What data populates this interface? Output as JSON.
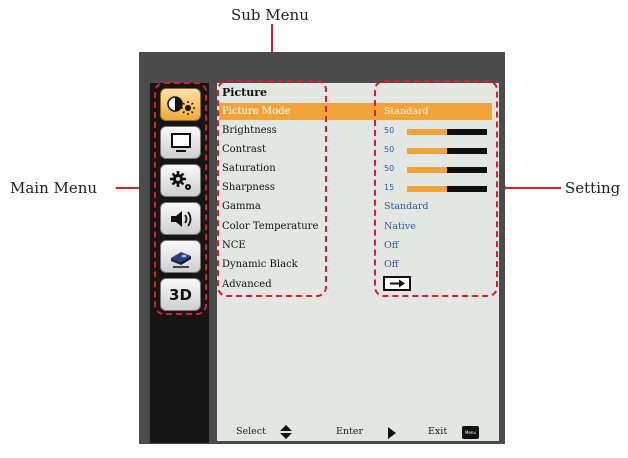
{
  "callouts": {
    "sub_menu": "Sub Menu",
    "main_menu": "Main Menu",
    "setting": "Setting"
  },
  "panel_title": "Picture",
  "menu_items": [
    {
      "label": "Picture Mode",
      "value": "Standard",
      "selected": true
    },
    {
      "label": "Brightness",
      "value": "50",
      "level": 0.5
    },
    {
      "label": "Contrast",
      "value": "50",
      "level": 0.5
    },
    {
      "label": "Saturation",
      "value": "50",
      "level": 0.5
    },
    {
      "label": "Sharpness",
      "value": "15",
      "level": 0.5
    },
    {
      "label": "Gamma",
      "value": "Standard"
    },
    {
      "label": "Color Temperature",
      "value": "Native"
    },
    {
      "label": "NCE",
      "value": "Off"
    },
    {
      "label": "Dynamic Black",
      "value": "Off"
    },
    {
      "label": "Advanced",
      "value_icon": "enter-arrow-icon"
    }
  ],
  "sidebar_icons": [
    "picture-icon",
    "screen-icon",
    "settings-icon",
    "volume-icon",
    "options-icon",
    "3d-icon"
  ],
  "sidebar_3d_label": "3D",
  "footer": {
    "select": "Select",
    "enter": "Enter",
    "exit": "Exit",
    "menu_key": "Menu"
  },
  "colors": {
    "highlight": "#f0a33a",
    "callout_red": "#d21f2a",
    "value_blue": "#2a5ca8",
    "panel_bg": "#e4e6e3"
  }
}
